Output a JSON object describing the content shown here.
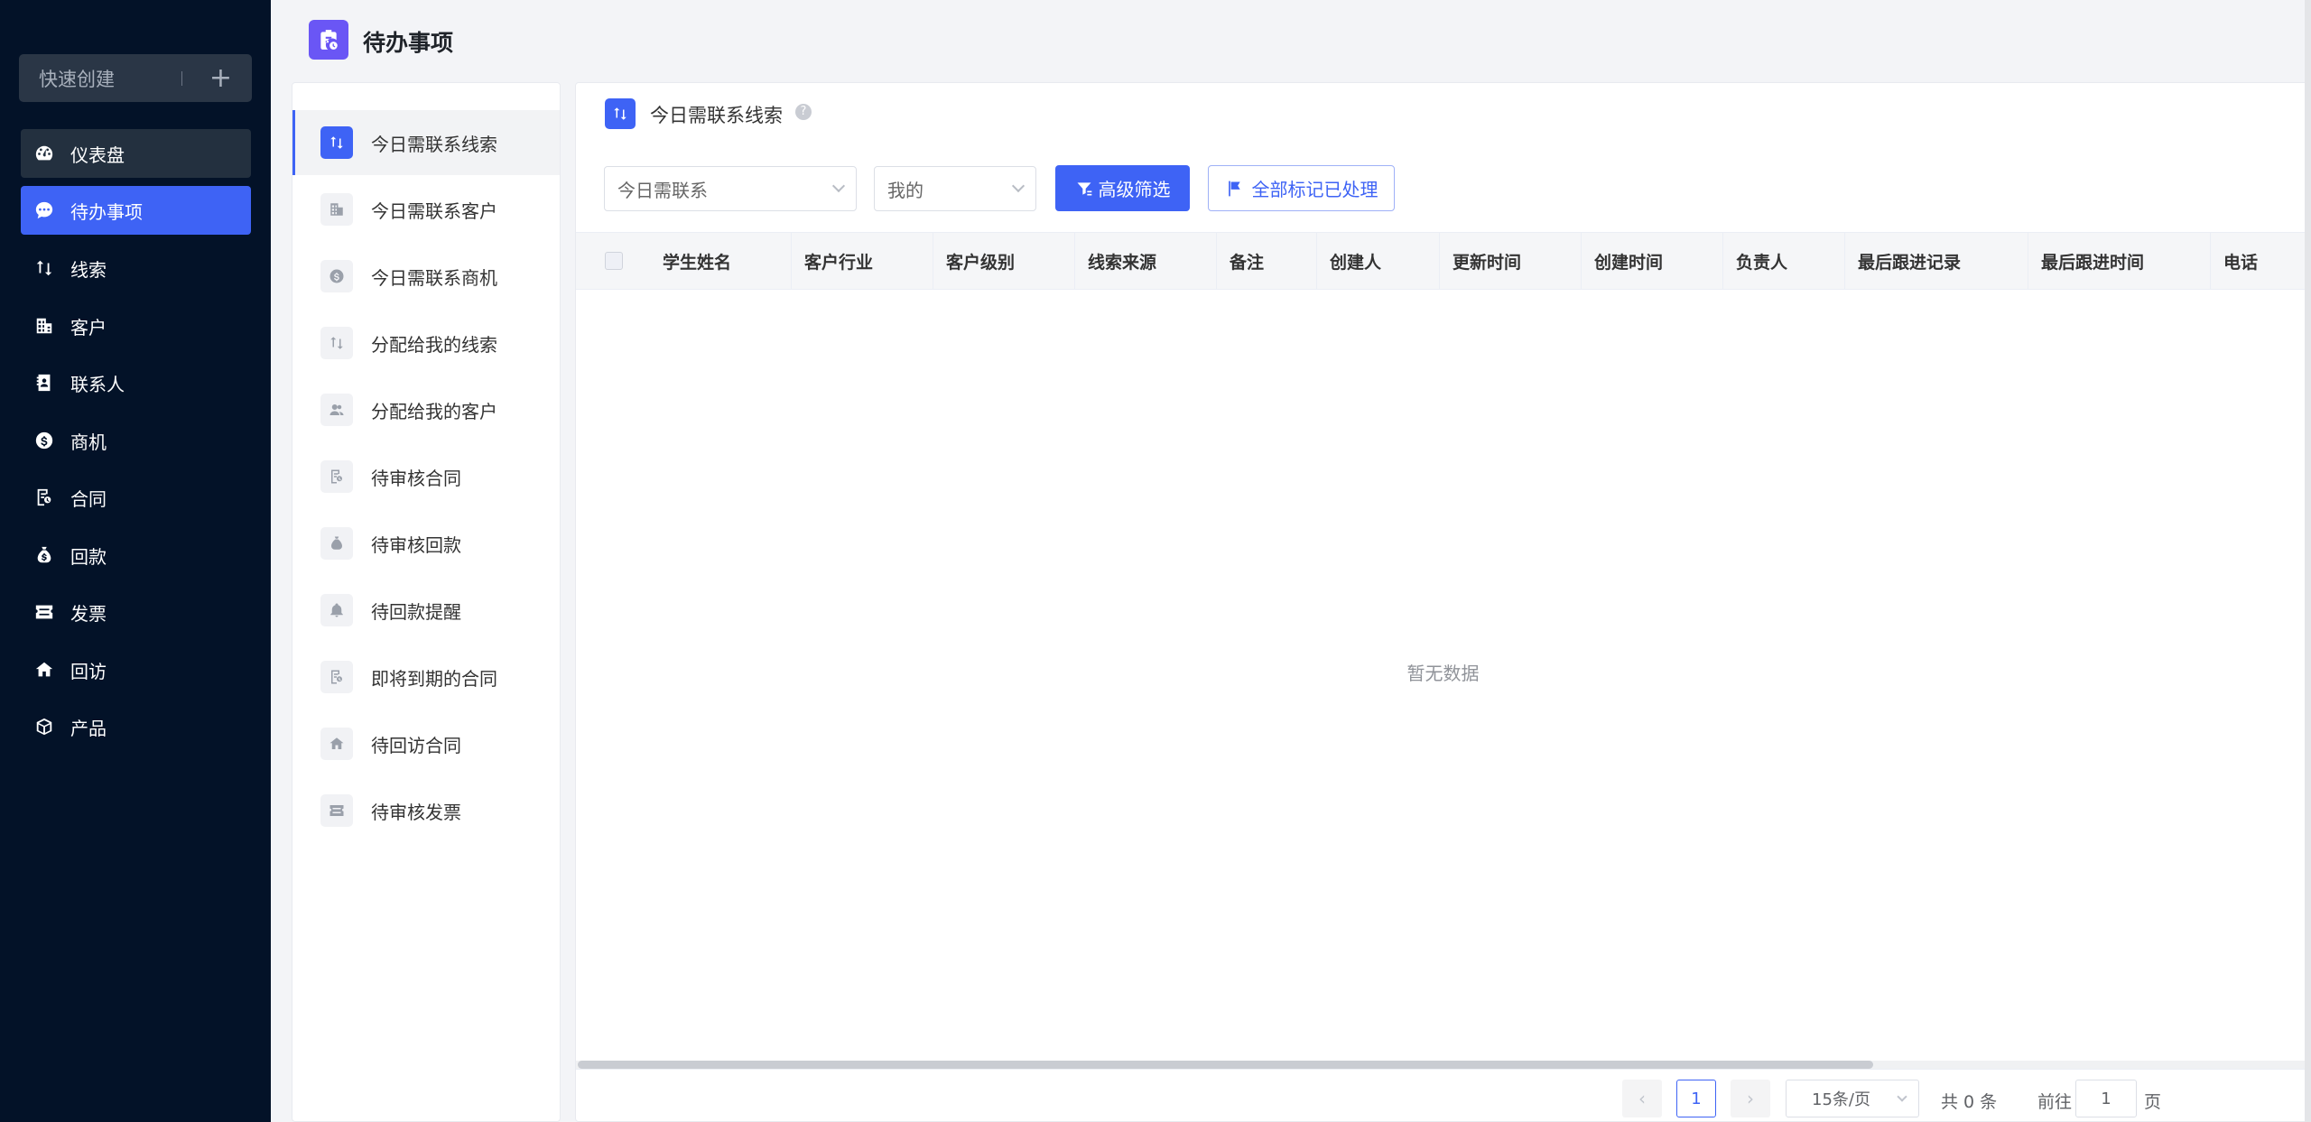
{
  "nav": {
    "quick_create": "快速创建",
    "items": [
      {
        "label": "仪表盘",
        "icon": "dashboard-icon"
      },
      {
        "label": "待办事项",
        "icon": "chat-icon"
      },
      {
        "label": "线索",
        "icon": "swap-icon"
      },
      {
        "label": "客户",
        "icon": "building-icon"
      },
      {
        "label": "联系人",
        "icon": "contact-book-icon"
      },
      {
        "label": "商机",
        "icon": "dollar-icon"
      },
      {
        "label": "合同",
        "icon": "contract-icon"
      },
      {
        "label": "回款",
        "icon": "money-bag-icon"
      },
      {
        "label": "发票",
        "icon": "invoice-icon"
      },
      {
        "label": "回访",
        "icon": "home-icon"
      },
      {
        "label": "产品",
        "icon": "box-icon"
      }
    ],
    "active_index": 1
  },
  "header": {
    "title": "待办事项"
  },
  "categories": [
    {
      "label": "今日需联系线索",
      "active": true
    },
    {
      "label": "今日需联系客户"
    },
    {
      "label": "今日需联系商机"
    },
    {
      "label": "分配给我的线索"
    },
    {
      "label": "分配给我的客户"
    },
    {
      "label": "待审核合同"
    },
    {
      "label": "待审核回款"
    },
    {
      "label": "待回款提醒"
    },
    {
      "label": "即将到期的合同"
    },
    {
      "label": "待回访合同"
    },
    {
      "label": "待审核发票"
    }
  ],
  "main": {
    "title": "今日需联系线索",
    "help": "?",
    "filter_time": "今日需联系",
    "filter_owner": "我的",
    "advanced_filter": "高级筛选",
    "mark_all": "全部标记已处理",
    "columns": [
      "学生姓名",
      "客户行业",
      "客户级别",
      "线索来源",
      "备注",
      "创建人",
      "更新时间",
      "创建时间",
      "负责人",
      "最后跟进记录",
      "最后跟进时间",
      "电话"
    ],
    "empty": "暂无数据"
  },
  "pagination": {
    "prev": "‹",
    "next": "›",
    "current_page": "1",
    "page_size": "15条/页",
    "total": "共 0 条",
    "goto_label": "前往",
    "goto_value": "1",
    "goto_unit": "页"
  },
  "colors": {
    "accent": "#3e63f5",
    "nav_bg": "#031228",
    "header_icon": "#6a56f5"
  }
}
